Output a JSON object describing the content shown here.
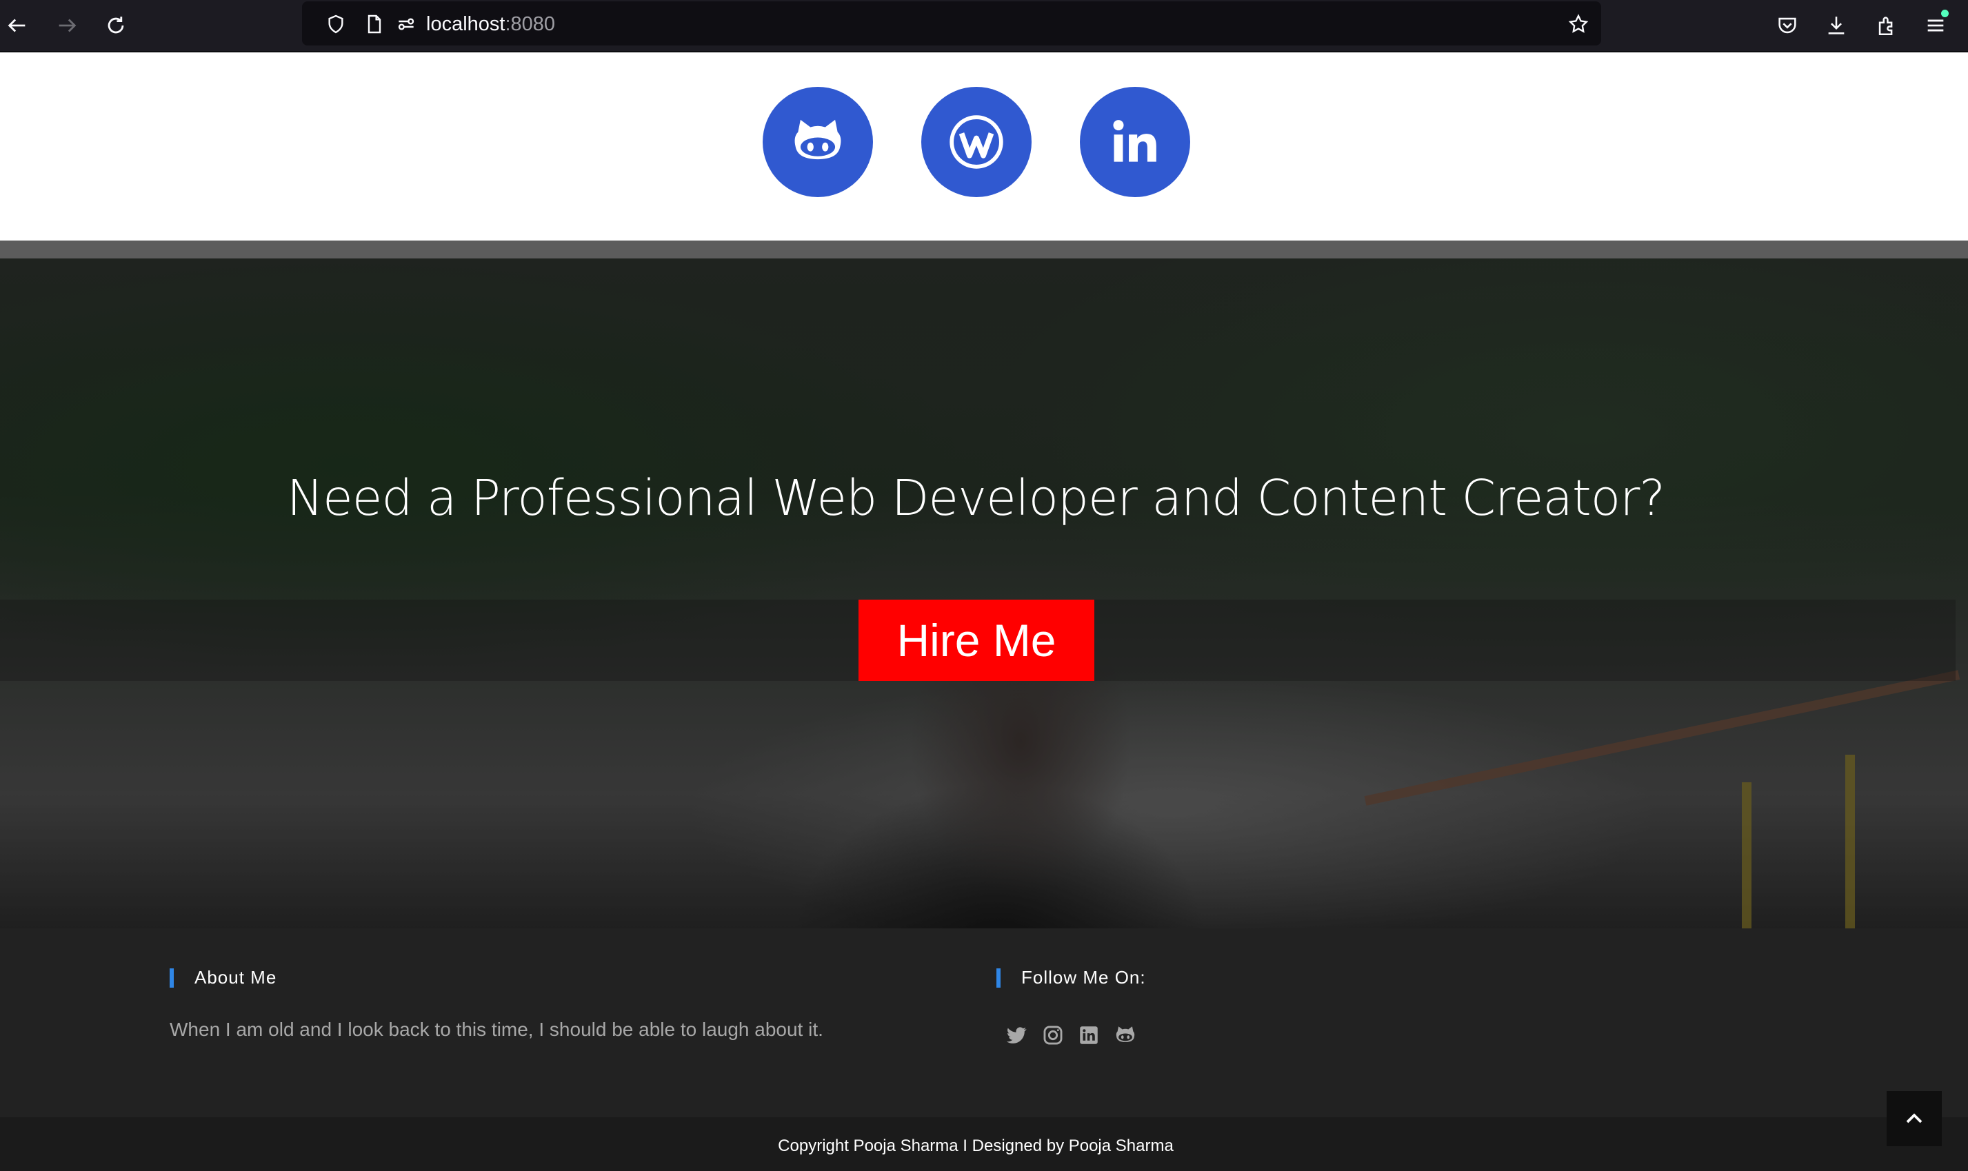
{
  "browser": {
    "url_host": "localhost",
    "url_port": ":8080",
    "icons": [
      "back-icon",
      "forward-icon",
      "reload-icon",
      "shield-icon",
      "page-icon",
      "permissions-icon",
      "bookmark-star-icon",
      "pocket-icon",
      "download-icon",
      "extensions-icon",
      "menu-icon"
    ]
  },
  "social": {
    "items": [
      {
        "name": "github",
        "icon": "github-icon"
      },
      {
        "name": "wordpress",
        "icon": "wordpress-icon"
      },
      {
        "name": "linkedin",
        "icon": "linkedin-icon"
      }
    ],
    "color": "#3059d0"
  },
  "hero": {
    "title": "Need a Professional Web Developer and Content Creator?",
    "cta_label": "Hire Me",
    "cta_color": "#ff0000"
  },
  "footer": {
    "about_heading": "About Me",
    "about_text": "When I am old and I look back to this time, I should be able to laugh about it.",
    "follow_heading": "Follow Me On:",
    "follow_icons": [
      "twitter-icon",
      "instagram-icon",
      "linkedin-icon",
      "github-icon"
    ],
    "accent": "#2f86e6"
  },
  "copyright": "Copyright Pooja Sharma I Designed by Pooja Sharma"
}
